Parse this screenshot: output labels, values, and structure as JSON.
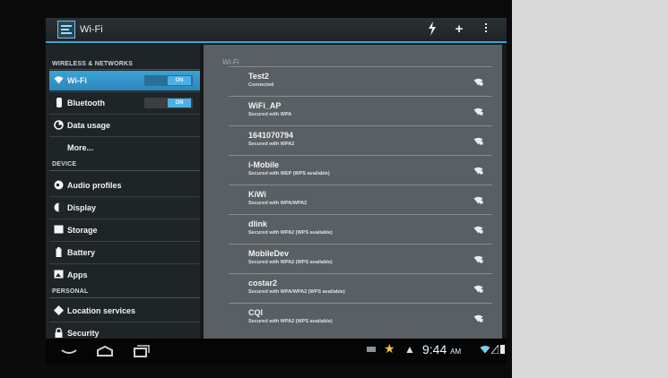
{
  "action_bar": {
    "title": "Wi-Fi",
    "icons": [
      "wps-icon",
      "add-icon",
      "overflow-menu-icon"
    ]
  },
  "sections": {
    "wireless": "WIRELESS & NETWORKS",
    "device": "DEVICE",
    "personal": "PERSONAL"
  },
  "nav": {
    "wifi": {
      "label": "Wi-Fi",
      "toggle": "ON",
      "icon": "wifi-icon"
    },
    "bluetooth": {
      "label": "Bluetooth",
      "toggle": "ON",
      "icon": "bluetooth-icon"
    },
    "data_usage": {
      "label": "Data usage",
      "icon": "data-usage-icon"
    },
    "more": {
      "label": "More..."
    },
    "audio_profiles": {
      "label": "Audio profiles",
      "icon": "audio-profiles-icon"
    },
    "display": {
      "label": "Display",
      "icon": "display-icon"
    },
    "storage": {
      "label": "Storage",
      "icon": "storage-icon"
    },
    "battery": {
      "label": "Battery",
      "icon": "battery-icon"
    },
    "apps": {
      "label": "Apps",
      "icon": "apps-icon"
    },
    "location": {
      "label": "Location services",
      "icon": "location-icon"
    },
    "security": {
      "label": "Security",
      "icon": "lock-icon"
    }
  },
  "right_pane": {
    "title": "Wi-Fi",
    "networks": [
      {
        "name": "Test2",
        "status": "Connected"
      },
      {
        "name": "WiFi_AP",
        "status": "Secured with WPA"
      },
      {
        "name": "1641070794",
        "status": "Secured with WPA2"
      },
      {
        "name": "i-Mobile",
        "status": "Secured with WEP (WPS available)"
      },
      {
        "name": "KiWi",
        "status": "Secured with WPA/WPA2"
      },
      {
        "name": "dlink",
        "status": "Secured with WPA2 (WPS available)"
      },
      {
        "name": "MobileDev",
        "status": "Secured with WPA2 (WPS available)"
      },
      {
        "name": "costar2",
        "status": "Secured with WPA/WPA2 (WPS available)"
      },
      {
        "name": "CQI",
        "status": "Secured with WPA2 (WPS available)"
      }
    ]
  },
  "system_bar": {
    "time": "9:44",
    "ampm": "AM",
    "accent": "#33a7d6"
  }
}
